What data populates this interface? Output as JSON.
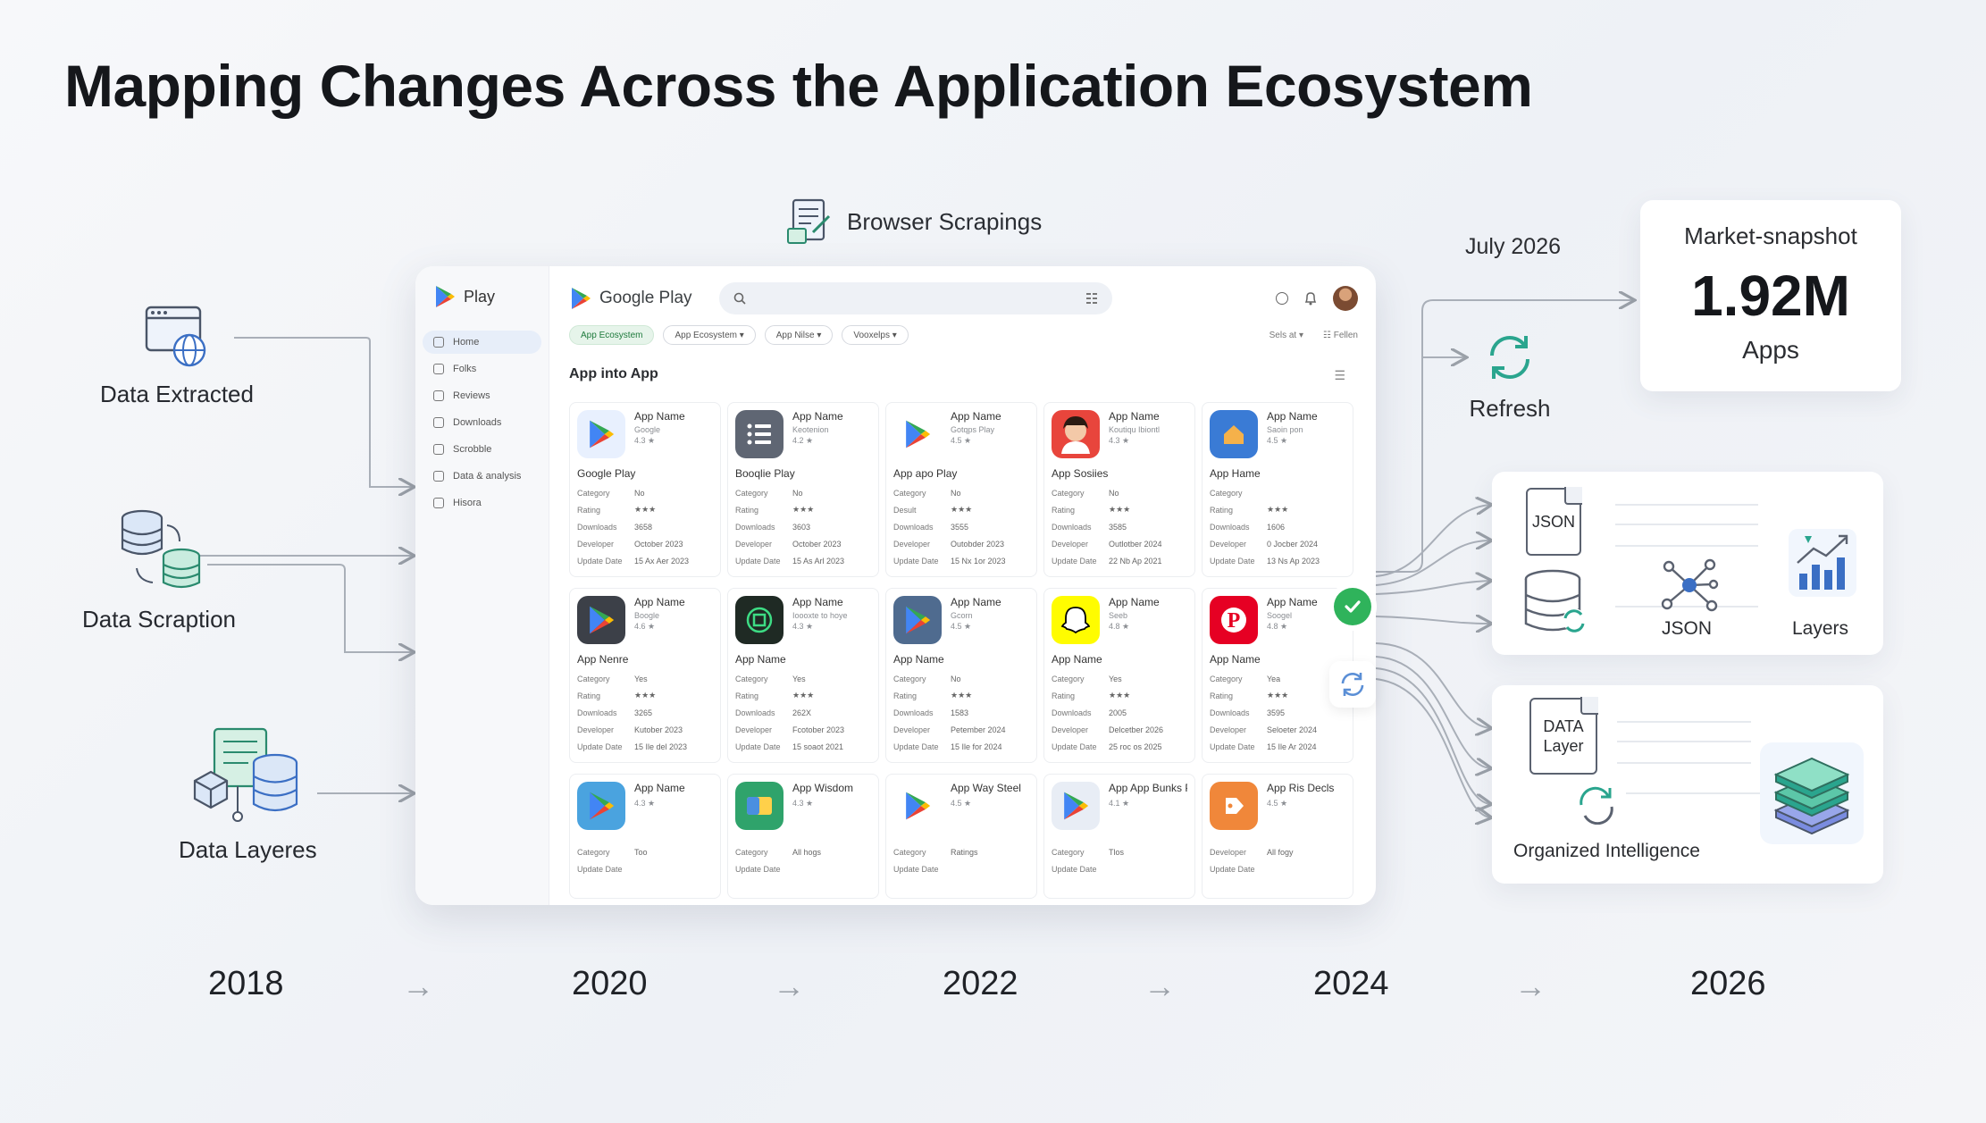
{
  "title": "Mapping Changes Across the Application Ecosystem",
  "sources": [
    {
      "label": "Data Extracted",
      "icon": "browser-globe-icon"
    },
    {
      "label": "Data Scraption",
      "icon": "database-sync-icon"
    },
    {
      "label": "Data Layeres",
      "icon": "data-layers-icon"
    }
  ],
  "browser_label": "Browser Scrapings",
  "mock": {
    "side_logo": "Play",
    "nav": [
      "Home",
      "Folks",
      "Reviews",
      "Downloads",
      "Scrobble",
      "Data & analysis",
      "Hisora"
    ],
    "brand": "Google Play",
    "chips": [
      "App Ecosystem",
      "App Ecosystem ▾",
      "App Nilse ▾",
      "Vooxelps ▾"
    ],
    "sort_label": "Sels at ▾",
    "filter_label": "Fellen",
    "section_title": "App into App",
    "apps": [
      {
        "name": "App Name",
        "sub": "Google",
        "rating": "4.3 ★",
        "title": "Google Play",
        "rows": [
          [
            "Category",
            "No"
          ],
          [
            "Rating",
            "★★★"
          ],
          [
            "Downloads",
            "3658"
          ],
          [
            "Developer",
            "October 2023"
          ],
          [
            "Update Date",
            "15 Ax Aer 2023"
          ]
        ],
        "icon": "play-logo",
        "bg": "#e8f0fe"
      },
      {
        "name": "App Name",
        "sub": "Keotenion",
        "rating": "4.2 ★",
        "title": "Booqlie Play",
        "rows": [
          [
            "Category",
            "No"
          ],
          [
            "Rating",
            "★★★"
          ],
          [
            "Downloads",
            "3603"
          ],
          [
            "Developer",
            "October 2023"
          ],
          [
            "Update Date",
            "15 As Arl 2023"
          ]
        ],
        "icon": "list-logo",
        "bg": "#5f6673"
      },
      {
        "name": "App Name",
        "sub": "Gotqps Play",
        "rating": "4.5 ★",
        "title": "App apo Play",
        "rows": [
          [
            "Category",
            "No"
          ],
          [
            "Desult",
            "★★★"
          ],
          [
            "Downloads",
            "3555"
          ],
          [
            "Developer",
            "Outobder 2023"
          ],
          [
            "Update Date",
            "15 Nx 1or 2023"
          ]
        ],
        "icon": "play-logo",
        "bg": "#ffffff"
      },
      {
        "name": "App Name",
        "sub": "Koutiqu Ibiontl",
        "rating": "4.3 ★",
        "title": "App Sosiies",
        "rows": [
          [
            "Category",
            "No"
          ],
          [
            "Rating",
            "★★★"
          ],
          [
            "Downloads",
            "3585"
          ],
          [
            "Developer",
            "Outlotber 2024"
          ],
          [
            "Update Date",
            "22 Nb Ap 2021"
          ]
        ],
        "icon": "portrait-logo",
        "bg": "#e8453c"
      },
      {
        "name": "App Name",
        "sub": "Saoin pon",
        "rating": "4.5 ★",
        "title": "App Hame",
        "rows": [
          [
            "Category",
            ""
          ],
          [
            "Rating",
            "★★★"
          ],
          [
            "Downloads",
            "1606"
          ],
          [
            "Developer",
            "0 Jocber 2024"
          ],
          [
            "Update Date",
            "13 Ns Ap 2023"
          ]
        ],
        "icon": "home-logo",
        "bg": "#3a7bd5"
      },
      {
        "name": "App Name",
        "sub": "Boogle",
        "rating": "4.6 ★",
        "title": "App Nenre",
        "rows": [
          [
            "Category",
            "Yes"
          ],
          [
            "Rating",
            "★★★"
          ],
          [
            "Downloads",
            "3265"
          ],
          [
            "Developer",
            "Kutober 2023"
          ],
          [
            "Update Date",
            "15 Ile del 2023"
          ]
        ],
        "icon": "play-logo",
        "bg": "#3c4048"
      },
      {
        "name": "App Name",
        "sub": "Ioooxte to hoye",
        "rating": "4.3 ★",
        "title": "App Name",
        "rows": [
          [
            "Category",
            "Yes"
          ],
          [
            "Rating",
            "★★★"
          ],
          [
            "Downloads",
            "262X"
          ],
          [
            "Developer",
            "Fcotober 2023"
          ],
          [
            "Update Date",
            "15 soaot 2021"
          ]
        ],
        "icon": "circuit-logo",
        "bg": "#1f2a24"
      },
      {
        "name": "App Name",
        "sub": "Gcorn",
        "rating": "4.5 ★",
        "title": "App Name",
        "rows": [
          [
            "Category",
            "No"
          ],
          [
            "Rating",
            "★★★"
          ],
          [
            "Downloads",
            "1583"
          ],
          [
            "Developer",
            "Petember 2024"
          ],
          [
            "Update Date",
            "15 Ile for 2024"
          ]
        ],
        "icon": "play-logo",
        "bg": "#4f6b8f"
      },
      {
        "name": "App Name",
        "sub": "Seeb",
        "rating": "4.8 ★",
        "title": "App Name",
        "rows": [
          [
            "Category",
            "Yes"
          ],
          [
            "Rating",
            "★★★"
          ],
          [
            "Downloads",
            "2005"
          ],
          [
            "Developer",
            "Delcetber 2026"
          ],
          [
            "Update Date",
            "25 roc os 2025"
          ]
        ],
        "icon": "ghost-logo",
        "bg": "#fffc00"
      },
      {
        "name": "App Name",
        "sub": "Soogel",
        "rating": "4.8 ★",
        "title": "App Name",
        "rows": [
          [
            "Category",
            "Yea"
          ],
          [
            "Rating",
            "★★★"
          ],
          [
            "Downloads",
            "3595"
          ],
          [
            "Developer",
            "Seloeter 2024"
          ],
          [
            "Update Date",
            "15 Ile Ar 2024"
          ]
        ],
        "icon": "p-logo",
        "bg": "#e60023"
      },
      {
        "name": "App Name",
        "sub": "",
        "rating": "4.3 ★",
        "title": "",
        "rows": [
          [
            "Category",
            "Too"
          ],
          [
            "Update Date",
            ""
          ]
        ],
        "icon": "play-logo",
        "bg": "#4aa3df"
      },
      {
        "name": "App Wisdom",
        "sub": "",
        "rating": "4.3 ★",
        "title": "",
        "rows": [
          [
            "Category",
            "All hogs"
          ],
          [
            "Update Date",
            ""
          ]
        ],
        "icon": "wallet-logo",
        "bg": "#2fa36b"
      },
      {
        "name": "App Way Steel",
        "sub": "",
        "rating": "4.5 ★",
        "title": "",
        "rows": [
          [
            "Category",
            "Ratings"
          ],
          [
            "Update Date",
            ""
          ]
        ],
        "icon": "play-logo",
        "bg": "#ffffff"
      },
      {
        "name": "App App Bunks Play",
        "sub": "",
        "rating": "4.1 ★",
        "title": "",
        "rows": [
          [
            "Category",
            "Tlos"
          ],
          [
            "Update Date",
            ""
          ]
        ],
        "icon": "play-logo",
        "bg": "#e8edf5"
      },
      {
        "name": "App Ris Decls",
        "sub": "",
        "rating": "4.5 ★",
        "title": "",
        "rows": [
          [
            "Developer",
            "All fogy"
          ],
          [
            "Update Date",
            ""
          ]
        ],
        "icon": "tag-logo",
        "bg": "#f0873a"
      }
    ]
  },
  "july_label": "July 2026",
  "refresh_label": "Refresh",
  "snapshot": {
    "label": "Market-snapshot",
    "value": "1.92M",
    "unit": "Apps"
  },
  "panel1": {
    "doc_label": "JSON",
    "node_label": "JSON",
    "chart_label": "Layers"
  },
  "panel2": {
    "doc_label": "DATA Layer",
    "caption": "Organized Intelligence"
  },
  "timeline": [
    "2018",
    "2020",
    "2022",
    "2024",
    "2026"
  ],
  "colors": {
    "accent_green": "#2fb35b",
    "icon_blue": "#3b6fc4",
    "icon_teal": "#2aa58e",
    "line_gray": "#a9afb8"
  }
}
